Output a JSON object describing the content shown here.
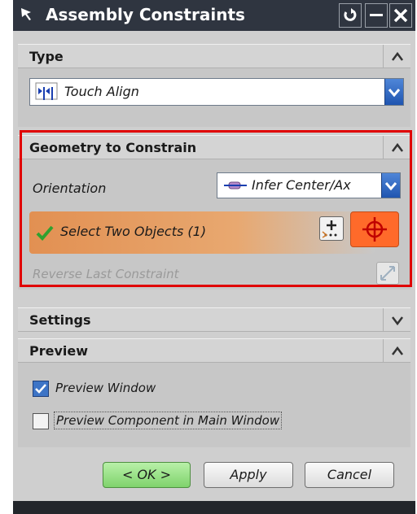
{
  "window": {
    "title": "Assembly Constraints"
  },
  "colors": {
    "titlebar": "#2f3540",
    "highlight_border": "#e00000",
    "selection_row": "#e8a26a",
    "ok_button": "#9be38c",
    "select_target": "#ff6a2a"
  },
  "sections": {
    "type": {
      "label": "Type",
      "dropdown_value": "Touch Align",
      "icon": "touch-align-icon"
    },
    "geometry": {
      "label": "Geometry to Constrain",
      "orientation_label": "Orientation",
      "orientation_value": "Infer Center/Ax",
      "select_label": "Select Two Objects (1)",
      "reverse_label": "Reverse Last Constraint"
    },
    "settings": {
      "label": "Settings"
    },
    "preview": {
      "label": "Preview",
      "preview_window_label": "Preview Window",
      "preview_window_checked": true,
      "preview_component_label": "Preview Component in Main Window",
      "preview_component_checked": false
    }
  },
  "buttons": {
    "ok": "< OK >",
    "apply": "Apply",
    "cancel": "Cancel"
  }
}
